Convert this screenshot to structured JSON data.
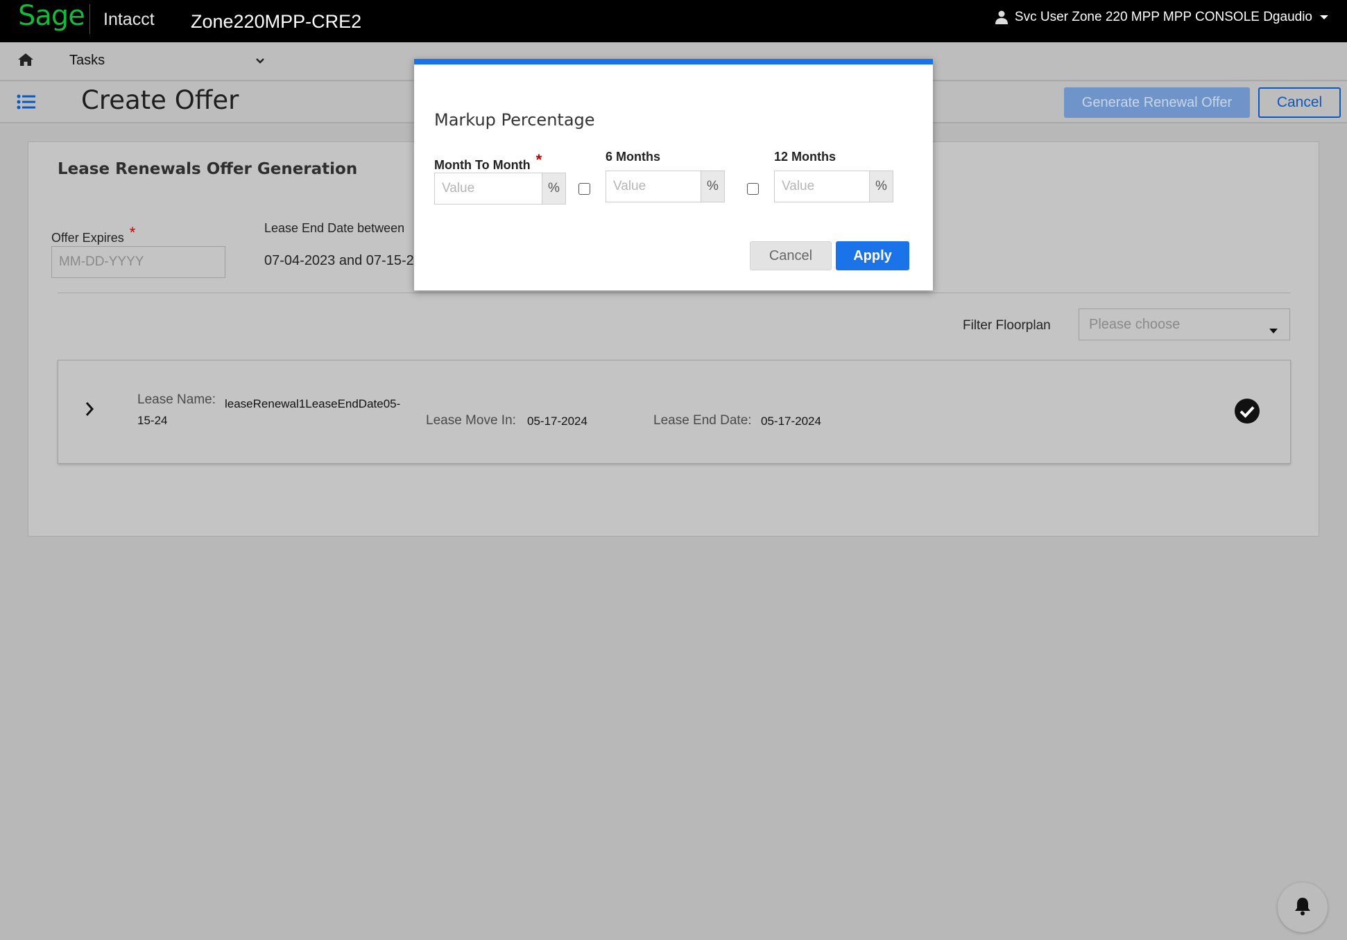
{
  "header": {
    "logo_text": "Sage",
    "product": "Intacct",
    "company": "Zone220MPP-CRE2",
    "user_name": "Svc User Zone 220 MPP MPP CONSOLE Dgaudio"
  },
  "nav": {
    "tasks_label": "Tasks"
  },
  "titlebar": {
    "page_title": "Create Offer",
    "generate_button": "Generate Renewal Offer",
    "cancel_button": "Cancel"
  },
  "card": {
    "title": "Lease Renewals Offer Generation",
    "offer_expires_label": "Offer Expires",
    "offer_expires_placeholder": "MM-DD-YYYY",
    "lease_end_label": "Lease End Date between",
    "lease_end_range": "07-04-2023 and 07-15-20",
    "filter_label": "Filter Floorplan",
    "filter_placeholder": "Please choose"
  },
  "lease": {
    "name_label": "Lease Name:",
    "name_value_line1": "leaseRenewal1LeaseEndDate05-",
    "name_value_line2": "15-24",
    "move_in_label": "Lease Move In:",
    "move_in_value": "05-17-2024",
    "end_label": "Lease End Date:",
    "end_value": "05-17-2024"
  },
  "modal": {
    "title": "Markup Percentage",
    "month_to_month_label": "Month To Month",
    "six_months_label": "6 Months",
    "twelve_months_label": "12 Months",
    "value_placeholder": "Value",
    "percent_suffix": "%",
    "cancel_button": "Cancel",
    "apply_button": "Apply",
    "required_mark": "*"
  },
  "colors": {
    "brand_green": "#15b83b",
    "primary_blue": "#1a73e8",
    "required_red": "#c00000"
  },
  "icons": [
    "user-icon",
    "caret-down-icon",
    "home-icon",
    "chevron-down-icon",
    "list-icon",
    "chevron-right-icon",
    "check-circle-icon",
    "bell-icon"
  ]
}
